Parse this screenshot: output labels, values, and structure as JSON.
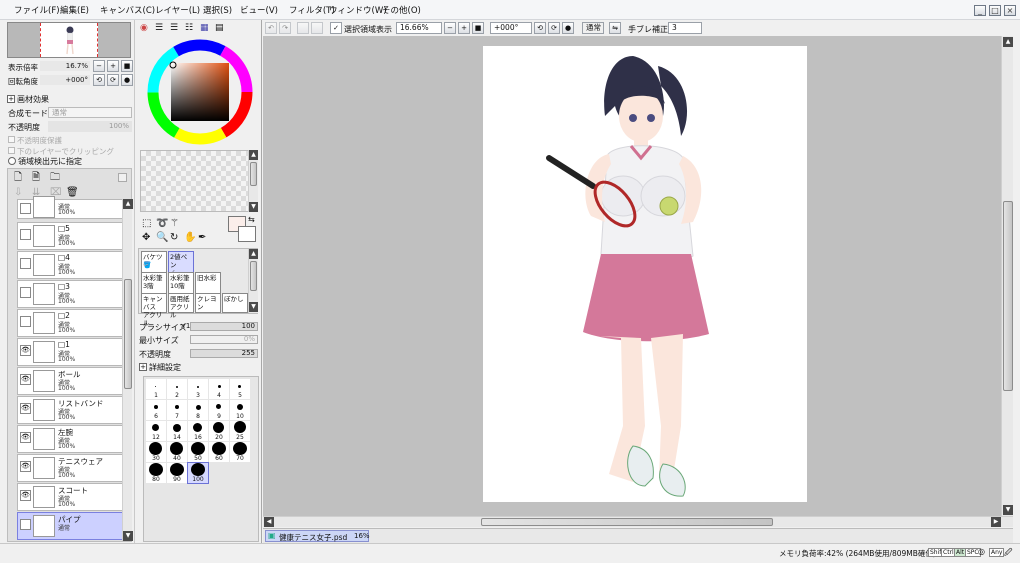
{
  "menu": [
    "ファイル(F)",
    "編集(E)",
    "キャンバス(C)",
    "レイヤー(L)",
    "選択(S)",
    "ビュー(V)",
    "フィルタ(T)",
    "ウィンドウ(W)",
    "その他(O)"
  ],
  "window_buttons": [
    "_",
    "□",
    "×"
  ],
  "toolbar": {
    "selection_checkbox_label": "選択領域表示",
    "zoom": "16.66%",
    "rotation": "+000°",
    "blend_mode": "通常",
    "stabilizer_label": "手ブレ補正",
    "stabilizer_value": "3"
  },
  "navigator": {
    "zoom_label": "表示倍率",
    "zoom_value": "16.7%",
    "rotate_label": "回転角度",
    "rotate_value": "+000°"
  },
  "layer_props": {
    "effect_label": "画材効果",
    "blend_label": "合成モード",
    "blend_value": "通常",
    "opacity_label": "不透明度",
    "opacity_value": "100%",
    "protect_label": "不透明度保護",
    "clip_label": "下のレイヤーでクリッピング",
    "select_source_label": "領域検出元に指定"
  },
  "layers": [
    {
      "name": "",
      "mode": "通常",
      "opacity": "100%",
      "visible": false,
      "selected": false
    },
    {
      "name": "□5",
      "mode": "通常",
      "opacity": "100%",
      "visible": false,
      "selected": false
    },
    {
      "name": "□4",
      "mode": "通常",
      "opacity": "100%",
      "visible": false,
      "selected": false
    },
    {
      "name": "□3",
      "mode": "通常",
      "opacity": "100%",
      "visible": false,
      "selected": false
    },
    {
      "name": "□2",
      "mode": "通常",
      "opacity": "100%",
      "visible": false,
      "selected": false
    },
    {
      "name": "□1",
      "mode": "通常",
      "opacity": "100%",
      "visible": true,
      "selected": false
    },
    {
      "name": "ボール",
      "mode": "通常",
      "opacity": "100%",
      "visible": true,
      "selected": false
    },
    {
      "name": "リストバンド",
      "mode": "通常",
      "opacity": "100%",
      "visible": true,
      "selected": false
    },
    {
      "name": "左腕",
      "mode": "通常",
      "opacity": "100%",
      "visible": true,
      "selected": false
    },
    {
      "name": "テニスウェア",
      "mode": "通常",
      "opacity": "100%",
      "visible": true,
      "selected": false
    },
    {
      "name": "スコート",
      "mode": "通常",
      "opacity": "100%",
      "visible": true,
      "selected": false
    },
    {
      "name": "パイプ",
      "mode": "通常",
      "opacity": "",
      "visible": false,
      "selected": true
    }
  ],
  "tools": [
    {
      "label": "バケツ",
      "sub": "",
      "active": false
    },
    {
      "label": "2値ペン",
      "sub": "",
      "active": true
    },
    {
      "label": "水彩筆",
      "sub": "3階",
      "active": false
    },
    {
      "label": "水彩筆",
      "sub": "10階",
      "active": false
    },
    {
      "label": "旧水彩",
      "sub": "",
      "active": false
    },
    {
      "label": "キャンバス",
      "sub": "アクリル",
      "active": false
    },
    {
      "label": "画用紙",
      "sub": "アクリル",
      "active": false
    },
    {
      "label": "クレヨン",
      "sub": "",
      "active": false
    },
    {
      "label": "ぼかし",
      "sub": "",
      "active": false
    }
  ],
  "brush": {
    "size_label": "ブラシサイズ",
    "size_mult": "×1.0",
    "size_value": "100",
    "min_label": "最小サイズ",
    "min_value": "0%",
    "density_label": "不透明度",
    "density_value": "255",
    "detail_label": "詳細設定"
  },
  "brush_sizes": [
    "1",
    "2",
    "3",
    "4",
    "5",
    "6",
    "7",
    "8",
    "9",
    "10",
    "12",
    "14",
    "16",
    "20",
    "25",
    "30",
    "40",
    "50",
    "60",
    "70",
    "80",
    "90",
    "100"
  ],
  "selected_brush_size": "100",
  "document_tab": {
    "name": "健康テニス女子.psd",
    "zoom": "16%"
  },
  "status": {
    "memory": "メモリ負荷率:42% (264MB使用/809MB確保)",
    "keys": [
      "Shift",
      "Ctrl",
      "Alt",
      "SPC",
      "◎",
      "Any",
      "🖉"
    ]
  },
  "colors": {
    "accent": "#7a80e0",
    "canvas_bg": "#c0c0c0",
    "fg": "#fbeeea",
    "bg": "#ffffff"
  }
}
